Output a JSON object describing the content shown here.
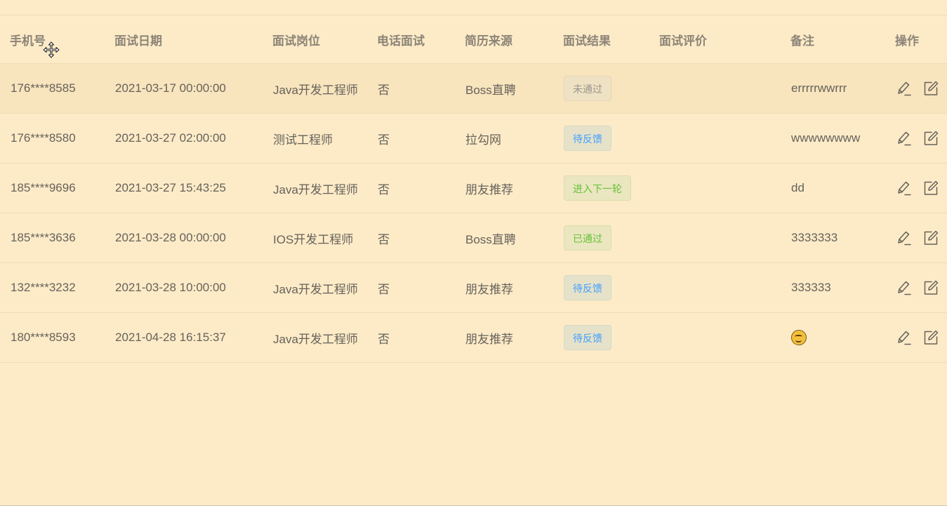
{
  "table": {
    "headers": [
      "手机号",
      "面试日期",
      "面试岗位",
      "电话面试",
      "简历来源",
      "面试结果",
      "面试评价",
      "备注",
      "操作"
    ],
    "rows": [
      {
        "phone": "176****8585",
        "date": "2021-03-17 00:00:00",
        "position": "Java开发工程师",
        "phone_interview": "否",
        "source": "Boss直聘",
        "result": "未通过",
        "result_type": "info",
        "evaluation": "",
        "remark": "errrrrwwrrr",
        "remark_is_emoji": false
      },
      {
        "phone": "176****8580",
        "date": "2021-03-27 02:00:00",
        "position": "测试工程师",
        "phone_interview": "否",
        "source": "拉勾网",
        "result": "待反馈",
        "result_type": "primary",
        "evaluation": "",
        "remark": "wwwwwwww",
        "remark_is_emoji": false
      },
      {
        "phone": "185****9696",
        "date": "2021-03-27 15:43:25",
        "position": "Java开发工程师",
        "phone_interview": "否",
        "source": "朋友推荐",
        "result": "进入下一轮",
        "result_type": "success",
        "evaluation": "",
        "remark": "dd",
        "remark_is_emoji": false
      },
      {
        "phone": "185****3636",
        "date": "2021-03-28 00:00:00",
        "position": "IOS开发工程师",
        "phone_interview": "否",
        "source": "Boss直聘",
        "result": "已通过",
        "result_type": "success",
        "evaluation": "",
        "remark": "3333333",
        "remark_is_emoji": false
      },
      {
        "phone": "132****3232",
        "date": "2021-03-28 10:00:00",
        "position": "Java开发工程师",
        "phone_interview": "否",
        "source": "朋友推荐",
        "result": "待反馈",
        "result_type": "primary",
        "evaluation": "",
        "remark": "333333",
        "remark_is_emoji": false
      },
      {
        "phone": "180****8593",
        "date": "2021-04-28 16:15:37",
        "position": "Java开发工程师",
        "phone_interview": "否",
        "source": "朋友推荐",
        "result": "待反馈",
        "result_type": "primary",
        "evaluation": "",
        "remark": "",
        "remark_is_emoji": true
      }
    ],
    "hovered_row_index": 0
  },
  "icons": {
    "edit_action": "pencil-edit-icon",
    "detail_action": "square-edit-icon",
    "cursor": "move-cursor-icon",
    "emoji": "smiling-face-icon"
  },
  "colors": {
    "background": "#fdebc7",
    "row_hover": "#f8e4bd",
    "tag_primary_text": "#409eff",
    "tag_success_text": "#67c23a",
    "tag_info_text": "#9a958c"
  }
}
